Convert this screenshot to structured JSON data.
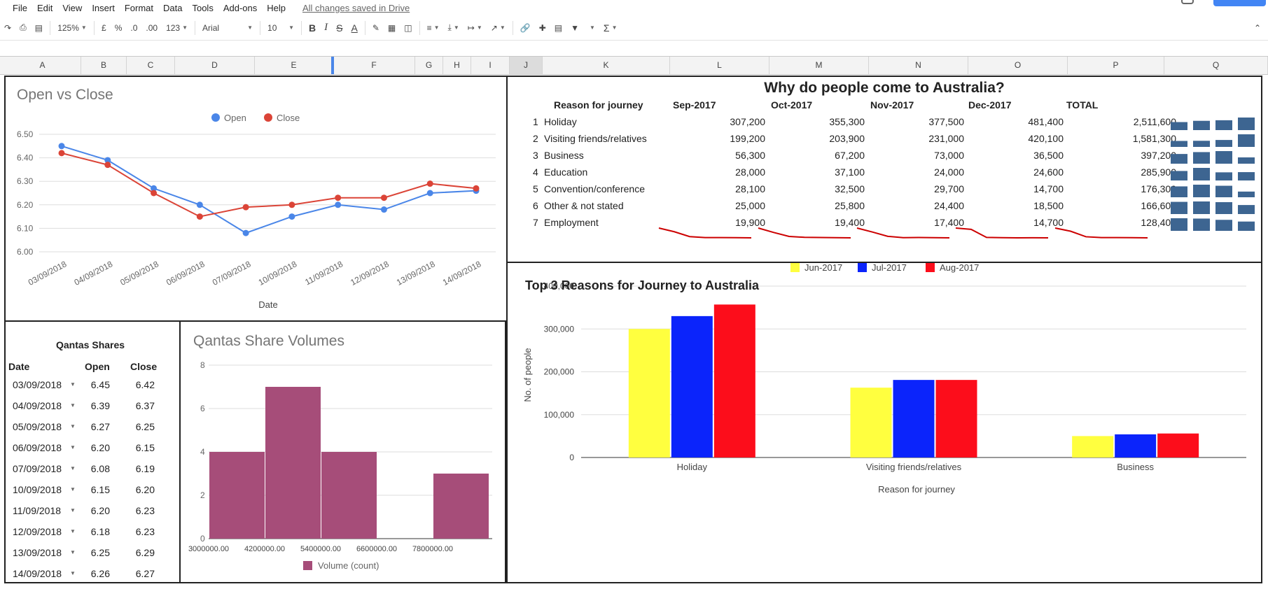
{
  "menu": {
    "items": [
      "File",
      "Edit",
      "View",
      "Insert",
      "Format",
      "Data",
      "Tools",
      "Add-ons",
      "Help"
    ],
    "saved_status": "All changes saved in Drive"
  },
  "toolbar": {
    "zoom": "125%",
    "currency": "£",
    "percent": "%",
    "decimal_decrease": ".0",
    "decimal_increase": ".00",
    "number_format": "123",
    "font": "Arial",
    "font_size": "10",
    "bold": "B",
    "italic": "I",
    "strike": "S",
    "text_color": "A",
    "sum": "Σ"
  },
  "columns": [
    "A",
    "B",
    "C",
    "D",
    "E",
    "F",
    "G",
    "H",
    "I",
    "J",
    "K",
    "L",
    "M",
    "N",
    "O",
    "P",
    "Q"
  ],
  "open_close_chart": {
    "title": "Open vs Close",
    "legend": [
      "Open",
      "Close"
    ],
    "xlabel": "Date",
    "colors": {
      "open": "#4a86e8",
      "close": "#db4437"
    },
    "chart_data": {
      "type": "line",
      "x": [
        "03/09/2018",
        "04/09/2018",
        "05/09/2018",
        "06/09/2018",
        "07/09/2018",
        "10/09/2018",
        "11/09/2018",
        "12/09/2018",
        "13/09/2018",
        "14/09/2018"
      ],
      "series": [
        {
          "name": "Open",
          "values": [
            6.45,
            6.39,
            6.27,
            6.2,
            6.08,
            6.15,
            6.2,
            6.18,
            6.25,
            6.26
          ]
        },
        {
          "name": "Close",
          "values": [
            6.42,
            6.37,
            6.25,
            6.15,
            6.19,
            6.2,
            6.23,
            6.23,
            6.29,
            6.27
          ]
        }
      ],
      "ylim": [
        6.0,
        6.5
      ],
      "yticks": [
        "6.00",
        "6.10",
        "6.20",
        "6.30",
        "6.40",
        "6.50"
      ],
      "grid": true,
      "legend_position": "top"
    }
  },
  "qantas_table": {
    "title": "Qantas Shares",
    "headers": [
      "Date",
      "Open",
      "Close"
    ],
    "rows": [
      [
        "03/09/2018",
        "6.45",
        "6.42"
      ],
      [
        "04/09/2018",
        "6.39",
        "6.37"
      ],
      [
        "05/09/2018",
        "6.27",
        "6.25"
      ],
      [
        "06/09/2018",
        "6.20",
        "6.15"
      ],
      [
        "07/09/2018",
        "6.08",
        "6.19"
      ],
      [
        "10/09/2018",
        "6.15",
        "6.20"
      ],
      [
        "11/09/2018",
        "6.20",
        "6.23"
      ],
      [
        "12/09/2018",
        "6.18",
        "6.23"
      ],
      [
        "13/09/2018",
        "6.25",
        "6.29"
      ],
      [
        "14/09/2018",
        "6.26",
        "6.27"
      ]
    ]
  },
  "volume_chart": {
    "title": "Qantas Share Volumes",
    "legend": "Volume (count)",
    "color": "#a64d79",
    "chart_data": {
      "type": "bar",
      "categories": [
        "3000000.00",
        "4200000.00",
        "5400000.00",
        "6600000.00",
        "7800000.00"
      ],
      "values": [
        4,
        7,
        4,
        0,
        3
      ],
      "ylim": [
        0,
        8
      ],
      "yticks": [
        "0",
        "2",
        "4",
        "6",
        "8"
      ],
      "grid": true,
      "legend_position": "bottom"
    }
  },
  "australia_table": {
    "title": "Why do people come to Australia?",
    "headers": [
      "Reason for journey",
      "Sep-2017",
      "Oct-2017",
      "Nov-2017",
      "Dec-2017",
      "TOTAL"
    ],
    "rows": [
      {
        "num": "1",
        "reason": "Holiday",
        "values": [
          "307,200",
          "355,300",
          "377,500",
          "481,400"
        ],
        "total": "2,511,600",
        "raw": [
          307200,
          355300,
          377500,
          481400
        ]
      },
      {
        "num": "2",
        "reason": "Visiting friends/relatives",
        "values": [
          "199,200",
          "203,900",
          "231,000",
          "420,100"
        ],
        "total": "1,581,300",
        "raw": [
          199200,
          203900,
          231000,
          420100
        ]
      },
      {
        "num": "3",
        "reason": "Business",
        "values": [
          "56,300",
          "67,200",
          "73,000",
          "36,500"
        ],
        "total": "397,200",
        "raw": [
          56300,
          67200,
          73000,
          36500
        ]
      },
      {
        "num": "4",
        "reason": "Education",
        "values": [
          "28,000",
          "37,100",
          "24,000",
          "24,600"
        ],
        "total": "285,900",
        "raw": [
          28000,
          37100,
          24000,
          24600
        ]
      },
      {
        "num": "5",
        "reason": "Convention/conference",
        "values": [
          "28,100",
          "32,500",
          "29,700",
          "14,700"
        ],
        "total": "176,300",
        "raw": [
          28100,
          32500,
          29700,
          14700
        ]
      },
      {
        "num": "6",
        "reason": "Other & not stated",
        "values": [
          "25,000",
          "25,800",
          "24,400",
          "18,500"
        ],
        "total": "166,600",
        "raw": [
          25000,
          25800,
          24400,
          18500
        ]
      },
      {
        "num": "7",
        "reason": "Employment",
        "values": [
          "19,900",
          "19,400",
          "17,400",
          "14,700"
        ],
        "total": "128,400",
        "raw": [
          19900,
          19400,
          17400,
          14700
        ]
      }
    ],
    "sparkline_color": "#cc0000",
    "spark_bar_color": "#3d6591"
  },
  "top3_chart": {
    "title": "Top 3 Reasons for Journey to Australia",
    "xlabel": "Reason for journey",
    "ylabel": "No. of people",
    "colors": [
      "#ffff3f",
      "#0b24fb",
      "#fc0d1b"
    ],
    "chart_data": {
      "type": "bar",
      "categories": [
        "Holiday",
        "Visiting friends/relatives",
        "Business"
      ],
      "series": [
        {
          "name": "Jun-2017",
          "values": [
            300000,
            163000,
            50000
          ]
        },
        {
          "name": "Jul-2017",
          "values": [
            330000,
            181000,
            54000
          ]
        },
        {
          "name": "Aug-2017",
          "values": [
            357000,
            181000,
            56000
          ]
        }
      ],
      "ylim": [
        0,
        400000
      ],
      "yticks": [
        "0",
        "100,000",
        "200,000",
        "300,000",
        "400,000"
      ],
      "grid": true,
      "legend_position": "top"
    }
  }
}
